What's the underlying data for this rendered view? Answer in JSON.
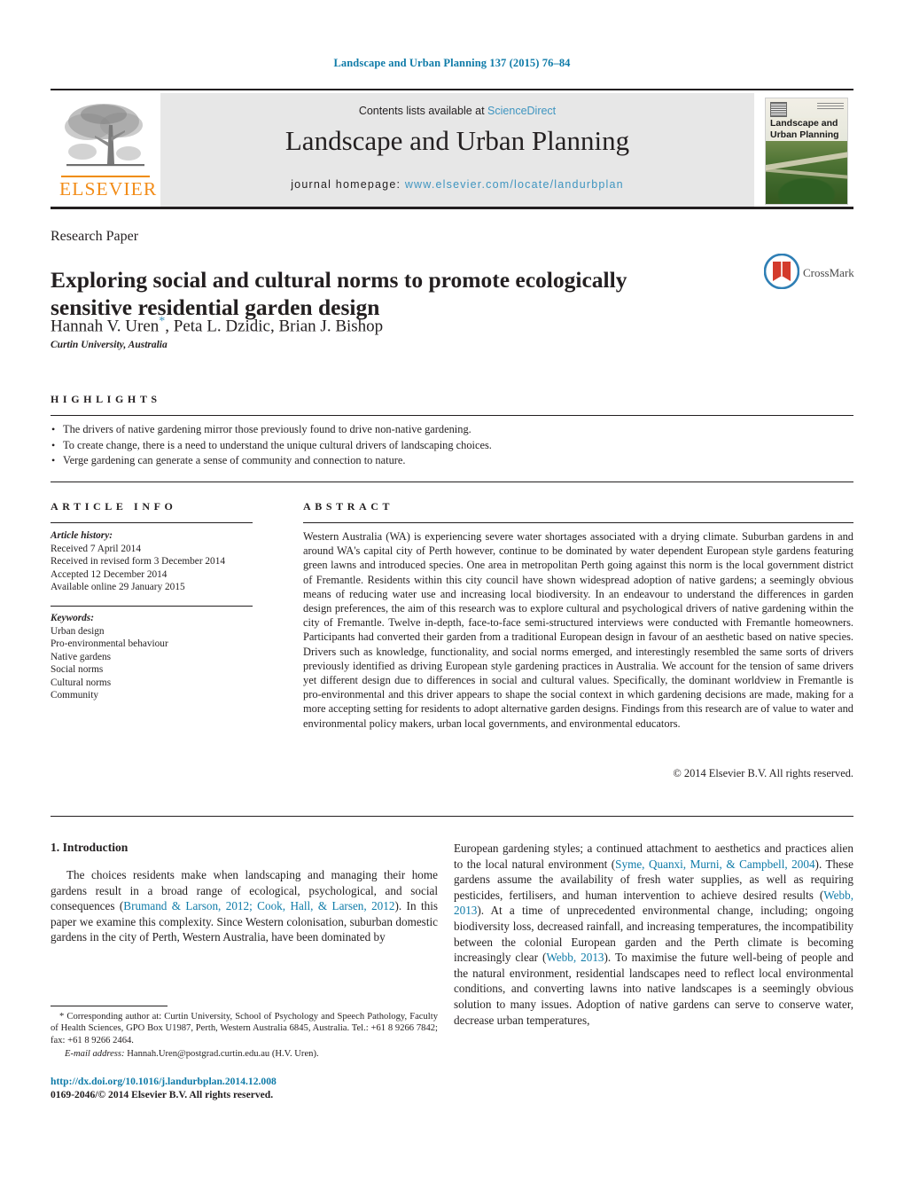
{
  "running_head": "Landscape and Urban Planning 137 (2015) 76–84",
  "masthead": {
    "publisher_name": "ELSEVIER",
    "contents_prefix": "Contents lists available at ",
    "contents_link": "ScienceDirect",
    "journal_title": "Landscape and Urban Planning",
    "homepage_label": "journal homepage: ",
    "homepage_url": "www.elsevier.com/locate/landurbplan",
    "cover_title_line1": "Landscape and",
    "cover_title_line2": "Urban Planning"
  },
  "article": {
    "section_type": "Research Paper",
    "title": "Exploring social and cultural norms to promote ecologically sensitive residential garden design",
    "authors": "Hannah V. Uren",
    "authors_rest": ", Peta L. Dzidic, Brian J. Bishop",
    "corresponding_marker": "*",
    "affiliation": "Curtin University, Australia",
    "crossmark_label": "CrossMark"
  },
  "highlights": {
    "heading": "HIGHLIGHTS",
    "items": [
      "The drivers of native gardening mirror those previously found to drive non-native gardening.",
      "To create change, there is a need to understand the unique cultural drivers of landscaping choices.",
      "Verge gardening can generate a sense of community and connection to nature."
    ]
  },
  "article_info": {
    "heading": "ARTICLE INFO",
    "history_label": "Article history:",
    "history": [
      "Received 7 April 2014",
      "Received in revised form 3 December 2014",
      "Accepted 12 December 2014",
      "Available online 29 January 2015"
    ],
    "keywords_label": "Keywords:",
    "keywords": [
      "Urban design",
      "Pro-environmental behaviour",
      "Native gardens",
      "Social norms",
      "Cultural norms",
      "Community"
    ]
  },
  "abstract": {
    "heading": "ABSTRACT",
    "text": "Western Australia (WA) is experiencing severe water shortages associated with a drying climate. Suburban gardens in and around WA's capital city of Perth however, continue to be dominated by water dependent European style gardens featuring green lawns and introduced species. One area in metropolitan Perth going against this norm is the local government district of Fremantle. Residents within this city council have shown widespread adoption of native gardens; a seemingly obvious means of reducing water use and increasing local biodiversity. In an endeavour to understand the differences in garden design preferences, the aim of this research was to explore cultural and psychological drivers of native gardening within the city of Fremantle. Twelve in-depth, face-to-face semi-structured interviews were conducted with Fremantle homeowners. Participants had converted their garden from a traditional European design in favour of an aesthetic based on native species. Drivers such as knowledge, functionality, and social norms emerged, and interestingly resembled the same sorts of drivers previously identified as driving European style gardening practices in Australia. We account for the tension of same drivers yet different design due to differences in social and cultural values. Specifically, the dominant worldview in Fremantle is pro-environmental and this driver appears to shape the social context in which gardening decisions are made, making for a more accepting setting for residents to adopt alternative garden designs. Findings from this research are of value to water and environmental policy makers, urban local governments, and environmental educators.",
    "copyright": "© 2014 Elsevier B.V. All rights reserved."
  },
  "body": {
    "intro_heading": "1. Introduction",
    "left_paragraph_part1": "The choices residents make when landscaping and managing their home gardens result in a broad range of ecological, psychological, and social consequences (",
    "left_citation1": "Brumand & Larson, 2012; Cook, Hall, & Larsen, 2012",
    "left_paragraph_part2": "). In this paper we examine this complexity. Since Western colonisation, suburban domestic gardens in the city of Perth, Western Australia, have been dominated by",
    "right_part1": "European gardening styles; a continued attachment to aesthetics and practices alien to the local natural environment (",
    "right_citation1": "Syme, Quanxi, Murni, & Campbell, 2004",
    "right_part2": "). These gardens assume the availability of fresh water supplies, as well as requiring pesticides, fertilisers, and human intervention to achieve desired results (",
    "right_citation2": "Webb, 2013",
    "right_part3": "). At a time of unprecedented environmental change, including; ongoing biodiversity loss, decreased rainfall, and increasing temperatures, the incompatibility between the colonial European garden and the Perth climate is becoming increasingly clear (",
    "right_citation3": "Webb, 2013",
    "right_part4": "). To maximise the future well-being of people and the natural environment, residential landscapes need to reflect local environmental conditions, and converting lawns into native landscapes is a seemingly obvious solution to many issues. Adoption of native gardens can serve to conserve water, decrease urban temperatures,"
  },
  "footnotes": {
    "corresponding": "* Corresponding author at: Curtin University, School of Psychology and Speech Pathology, Faculty of Health Sciences, GPO Box U1987, Perth, Western Australia 6845, Australia. Tel.: +61 8 9266 7842; fax: +61 8 9266 2464.",
    "email_label": "E-mail address:",
    "email": "Hannah.Uren@postgrad.curtin.edu.au",
    "email_suffix": "(H.V. Uren).",
    "doi": "http://dx.doi.org/10.1016/j.landurbplan.2014.12.008",
    "issn": "0169-2046/© 2014 Elsevier B.V. All rights reserved."
  },
  "colors": {
    "link_blue": "#0f7ba8",
    "sciencedirect_blue": "#3f95c0",
    "elsevier_orange": "#f28c18",
    "text_black": "#231f20"
  }
}
